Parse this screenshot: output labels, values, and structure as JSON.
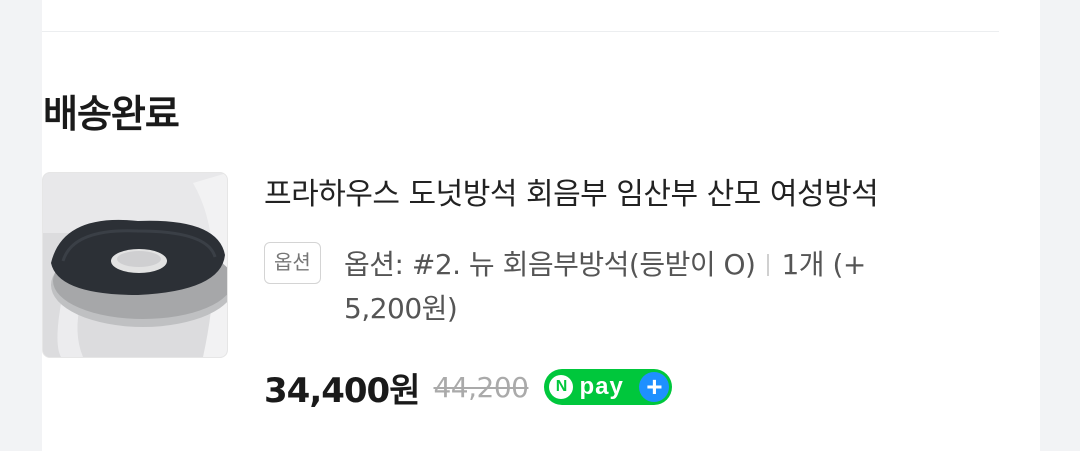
{
  "order": {
    "status": "배송완료",
    "product": {
      "title": "프라하우스 도넛방석 회음부 임산부 산모 여성방석",
      "option_badge": "옵션",
      "option_line1": "옵션: #2. 뉴 회음부방석(등받이 O)",
      "quantity": "1개 (+",
      "option_line2": "5,200원)",
      "price": "34,400원",
      "original_price": "44,200"
    },
    "payment": {
      "icon": "npay-plus-icon",
      "n_letter": "N",
      "pay_word": "pay",
      "plus": "+"
    }
  },
  "colors": {
    "background": "#f2f3f5",
    "card": "#ffffff",
    "npay_green": "#00c73c",
    "plus_blue": "#1e90ff"
  }
}
